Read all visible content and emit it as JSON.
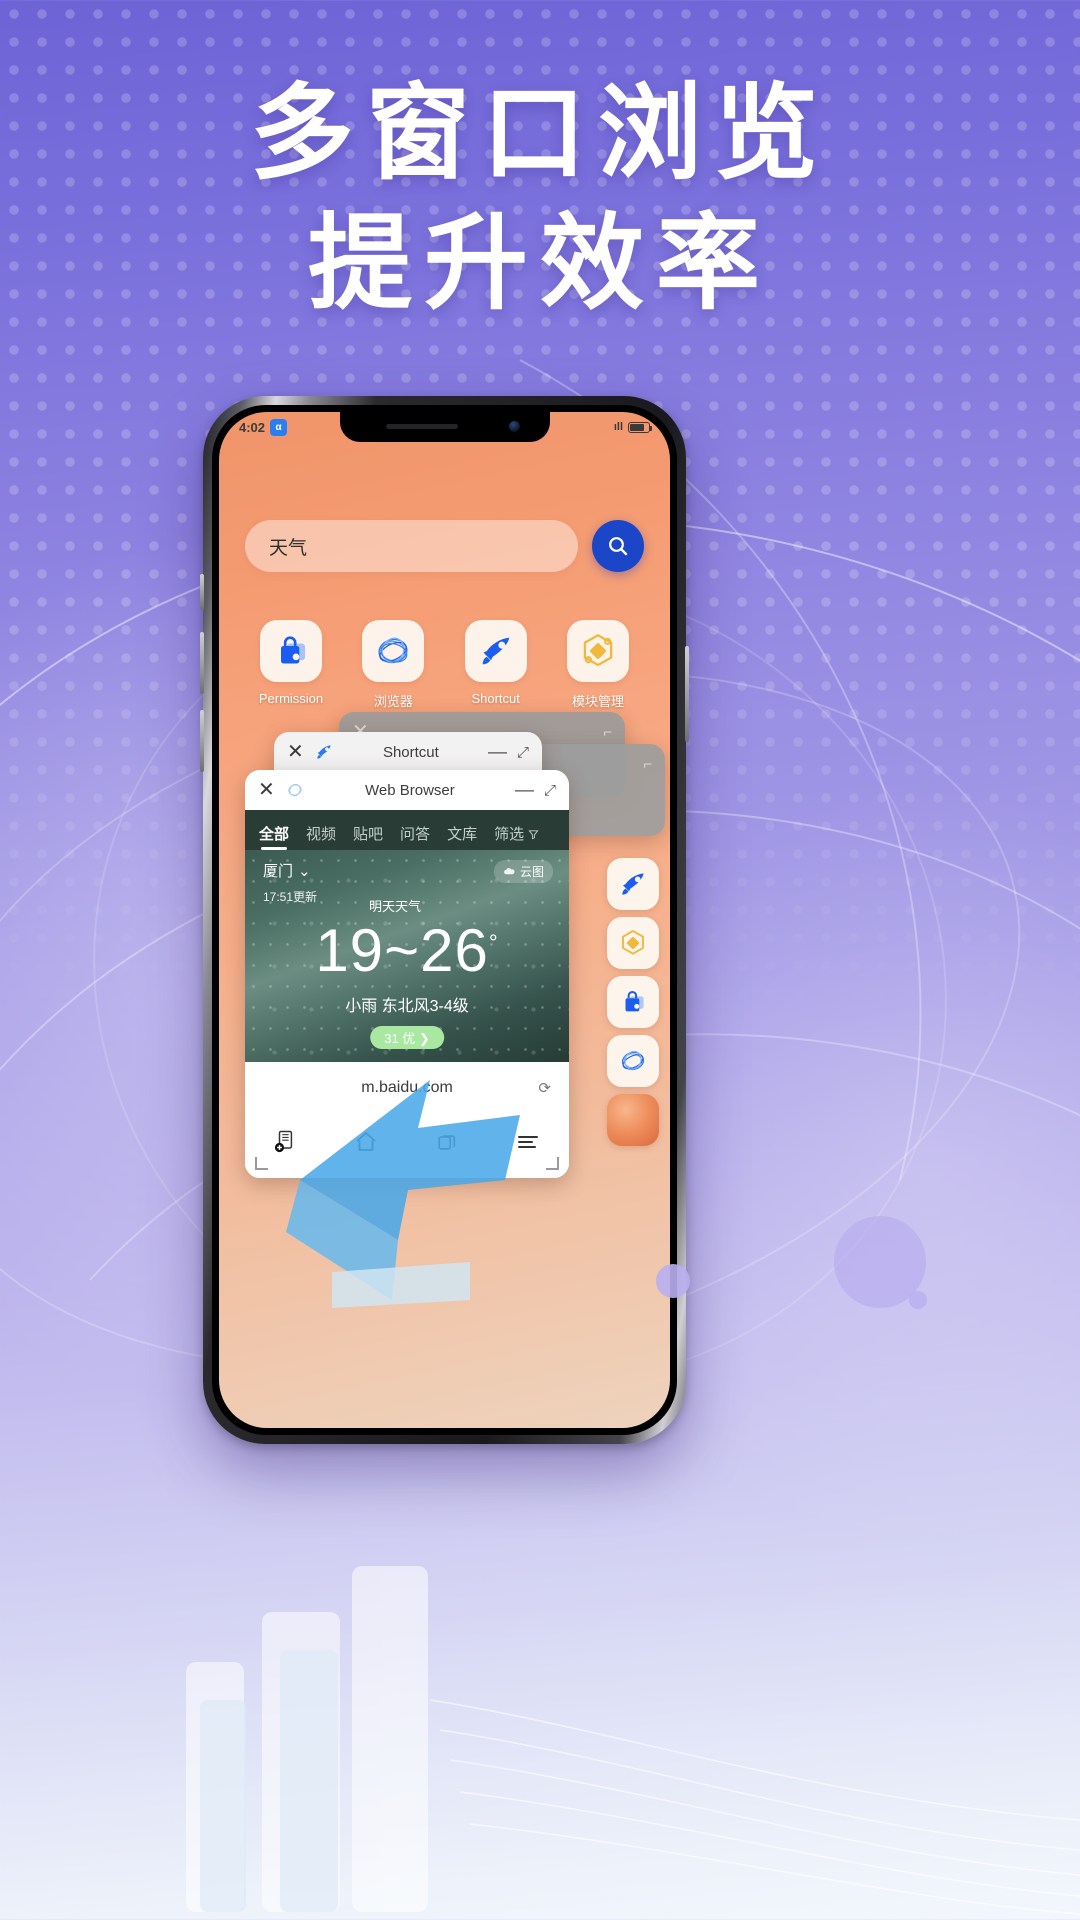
{
  "headline": {
    "line1": "多窗口浏览",
    "line2": "提升效率"
  },
  "phone": {
    "status": {
      "time": "4:02",
      "badge": "α",
      "signal": "ıll",
      "battery": "72"
    },
    "search": {
      "value": "天气",
      "placeholder": "天气",
      "button_icon": "search-icon"
    },
    "apps": [
      {
        "label": "Permission",
        "icon": "lock-bag-icon"
      },
      {
        "label": "浏览器",
        "icon": "browser-swirl-icon"
      },
      {
        "label": "Shortcut",
        "icon": "rocket-icon"
      },
      {
        "label": "模块管理",
        "icon": "module-hex-icon"
      }
    ],
    "windows": [
      {
        "title": "Shortcut",
        "icon": "rocket-icon",
        "close": "✕",
        "minimize": "—",
        "maximize": "⤢"
      },
      {
        "title": "Web Browser",
        "icon": "browser-swirl-icon",
        "close": "✕",
        "minimize": "—",
        "maximize": "⤢"
      }
    ],
    "browser": {
      "tabs": [
        {
          "label": "全部",
          "active": true
        },
        {
          "label": "视频",
          "active": false
        },
        {
          "label": "贴吧",
          "active": false
        },
        {
          "label": "问答",
          "active": false
        },
        {
          "label": "文库",
          "active": false
        },
        {
          "label": "筛选",
          "active": false
        }
      ],
      "filter_icon": "funnel-icon",
      "weather": {
        "city": "厦门",
        "city_chevron": "⌄",
        "updated": "17:51更新",
        "tomorrow": "明天天气",
        "cloud_map": "云图",
        "cloud_icon": "cloud-map-icon",
        "temp_low": "19",
        "temp_sep": "~",
        "temp_high": "26",
        "temp_unit": "°",
        "condition": "小雨  东北风3-4级",
        "aqi_badge": "31 优 ❯"
      },
      "url": "m.baidu.com",
      "reload_icon": "reload-icon",
      "toolbar": [
        {
          "icon": "add-bookmark-icon"
        },
        {
          "icon": "home-icon"
        },
        {
          "icon": "tabs-icon"
        },
        {
          "icon": "menu-icon"
        }
      ]
    },
    "dock": [
      {
        "icon": "rocket-icon"
      },
      {
        "icon": "module-hex-icon"
      },
      {
        "icon": "lock-bag-icon"
      },
      {
        "icon": "browser-swirl-icon"
      },
      {
        "icon": "ball-icon"
      }
    ]
  },
  "colors": {
    "bg_top": "#6d63d6",
    "bg_bottom": "#f3f7fd",
    "accent_blue": "#1c46c8",
    "icon_blue": "#1a5df0",
    "icon_gold": "#f0b93c",
    "screen_top": "#f0956a",
    "badge_green": "#a8e8a0"
  }
}
